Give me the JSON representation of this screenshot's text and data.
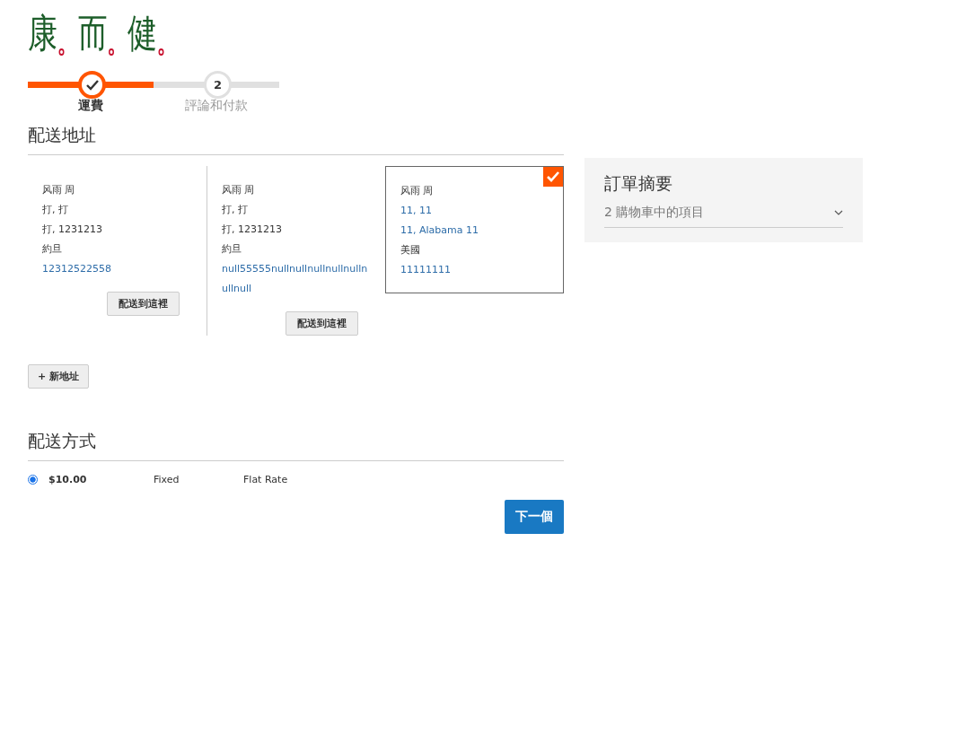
{
  "logo": {
    "characters": [
      "康",
      "而",
      "健"
    ]
  },
  "progress": {
    "steps": [
      {
        "label": "運費",
        "selected": true,
        "completed": true
      },
      {
        "number": "2",
        "label": "評論和付款",
        "selected": false,
        "completed": false
      }
    ]
  },
  "shipping_address": {
    "title": "配送地址",
    "addresses": [
      {
        "selected": false,
        "lines": [
          {
            "text": "风雨 周",
            "kind": "plain"
          },
          {
            "text": "打, 打",
            "kind": "plain"
          },
          {
            "text": "打, 1231213",
            "kind": "plain"
          },
          {
            "text": "約旦",
            "kind": "plain"
          },
          {
            "text": "12312522558",
            "kind": "link"
          }
        ],
        "button": "配送到這裡"
      },
      {
        "selected": false,
        "lines": [
          {
            "text": "风雨 周",
            "kind": "plain"
          },
          {
            "text": "打, 打",
            "kind": "plain"
          },
          {
            "text": "打, 1231213",
            "kind": "plain"
          },
          {
            "text": "約旦",
            "kind": "plain"
          },
          {
            "text": "null55555nullnullnullnullnullnullnull",
            "kind": "link"
          }
        ],
        "button": "配送到這裡"
      },
      {
        "selected": true,
        "lines": [
          {
            "text": "风雨 周",
            "kind": "plain"
          },
          {
            "text": "11, 11",
            "kind": "link"
          },
          {
            "text": "11, Alabama 11",
            "kind": "link"
          },
          {
            "text": "美國",
            "kind": "plain"
          },
          {
            "text": "11111111",
            "kind": "link"
          }
        ]
      }
    ],
    "new_address_button": "+ 新地址"
  },
  "shipping_method": {
    "title": "配送方式",
    "options": [
      {
        "selected": true,
        "price": "$10.00",
        "method": "Fixed",
        "carrier": "Flat Rate"
      }
    ],
    "next_button": "下一個"
  },
  "order_summary": {
    "title": "訂單摘要",
    "items_toggle": "2 購物車中的項目",
    "expanded": false
  }
}
